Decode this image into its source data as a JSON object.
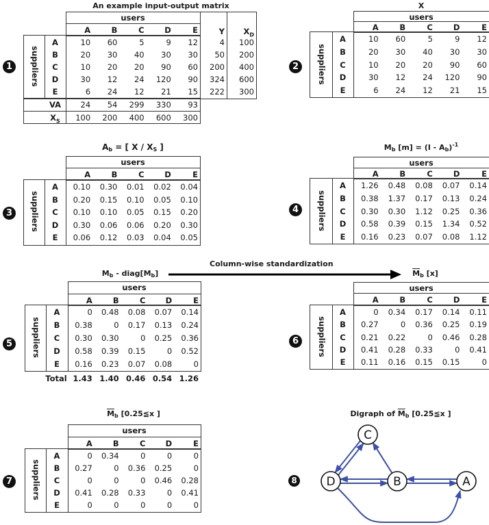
{
  "col_group_label": "users",
  "row_group_label": "suppliers",
  "columns": [
    "A",
    "B",
    "C",
    "D",
    "E"
  ],
  "rows": [
    "A",
    "B",
    "C",
    "D",
    "E"
  ],
  "panels": {
    "p1": {
      "badge": "1",
      "title": "An example input-output matrix",
      "extra_columns": [
        "Y",
        "X",
        "D"
      ],
      "values": [
        [
          "10",
          "60",
          "5",
          "9",
          "12"
        ],
        [
          "20",
          "30",
          "40",
          "30",
          "30"
        ],
        [
          "10",
          "20",
          "20",
          "90",
          "60"
        ],
        [
          "30",
          "12",
          "24",
          "120",
          "90"
        ],
        [
          "6",
          "24",
          "12",
          "21",
          "15"
        ]
      ],
      "y_values": [
        "4",
        "50",
        "200",
        "324",
        "222"
      ],
      "xd_values": [
        "100",
        "200",
        "400",
        "600",
        "300"
      ],
      "va_label": "VA",
      "va_values": [
        "24",
        "54",
        "299",
        "330",
        "93"
      ],
      "xs_label_main": "X",
      "xs_label_sub": "S",
      "xs_values": [
        "100",
        "200",
        "400",
        "600",
        "300"
      ]
    },
    "p2": {
      "badge": "2",
      "title": "X",
      "values": [
        [
          "10",
          "60",
          "5",
          "9",
          "12"
        ],
        [
          "20",
          "30",
          "40",
          "30",
          "30"
        ],
        [
          "10",
          "20",
          "20",
          "90",
          "60"
        ],
        [
          "30",
          "12",
          "24",
          "120",
          "90"
        ],
        [
          "6",
          "24",
          "12",
          "21",
          "15"
        ]
      ]
    },
    "p3": {
      "badge": "3",
      "title_parts": [
        "A",
        "b",
        " = [ X / X",
        "S",
        " ]"
      ],
      "values": [
        [
          "0.10",
          "0.30",
          "0.01",
          "0.02",
          "0.04"
        ],
        [
          "0.20",
          "0.15",
          "0.10",
          "0.05",
          "0.10"
        ],
        [
          "0.10",
          "0.10",
          "0.05",
          "0.15",
          "0.20"
        ],
        [
          "0.30",
          "0.06",
          "0.06",
          "0.20",
          "0.30"
        ],
        [
          "0.06",
          "0.12",
          "0.03",
          "0.04",
          "0.05"
        ]
      ]
    },
    "p4": {
      "badge": "4",
      "title_parts": [
        "M",
        "b",
        " [m]  =  (I - A",
        "b",
        ")",
        "-1"
      ],
      "values": [
        [
          "1.26",
          "0.48",
          "0.08",
          "0.07",
          "0.14"
        ],
        [
          "0.38",
          "1.37",
          "0.17",
          "0.13",
          "0.24"
        ],
        [
          "0.30",
          "0.30",
          "1.12",
          "0.25",
          "0.36"
        ],
        [
          "0.58",
          "0.39",
          "0.15",
          "1.34",
          "0.52"
        ],
        [
          "0.16",
          "0.23",
          "0.07",
          "0.08",
          "1.12"
        ]
      ]
    },
    "p5": {
      "badge": "5",
      "title_parts": [
        "M",
        "b",
        " - diag[M",
        "b",
        "]"
      ],
      "values": [
        [
          "0",
          "0.48",
          "0.08",
          "0.07",
          "0.14"
        ],
        [
          "0.38",
          "0",
          "0.17",
          "0.13",
          "0.24"
        ],
        [
          "0.30",
          "0.30",
          "0",
          "0.25",
          "0.36"
        ],
        [
          "0.58",
          "0.39",
          "0.15",
          "0",
          "0.52"
        ],
        [
          "0.16",
          "0.23",
          "0.07",
          "0.08",
          "0"
        ]
      ],
      "total_label": "Total",
      "totals": [
        "1.43",
        "1.40",
        "0.46",
        "0.54",
        "1.26"
      ]
    },
    "arrow": {
      "label": "Column-wise standardization"
    },
    "p6": {
      "badge": "6",
      "title_parts": [
        "M",
        "b",
        " [x]"
      ],
      "values": [
        [
          "0",
          "0.34",
          "0.17",
          "0.14",
          "0.11"
        ],
        [
          "0.27",
          "0",
          "0.36",
          "0.25",
          "0.19"
        ],
        [
          "0.21",
          "0.22",
          "0",
          "0.46",
          "0.28"
        ],
        [
          "0.41",
          "0.28",
          "0.33",
          "0",
          "0.41"
        ],
        [
          "0.11",
          "0.16",
          "0.15",
          "0.15",
          "0"
        ]
      ]
    },
    "p7": {
      "badge": "7",
      "title_parts": [
        "M",
        "b",
        " [0.25≦x ]"
      ],
      "values": [
        [
          "0",
          "0.34",
          "0",
          "0",
          "0"
        ],
        [
          "0.27",
          "0",
          "0.36",
          "0.25",
          "0"
        ],
        [
          "0",
          "0",
          "0",
          "0.46",
          "0.28"
        ],
        [
          "0.41",
          "0.28",
          "0.33",
          "0",
          "0.41"
        ],
        [
          "0",
          "0",
          "0",
          "0",
          "0"
        ]
      ]
    },
    "p8": {
      "badge": "8",
      "title_parts": [
        "Digraph of ",
        "M",
        "b",
        " [0.25≦x ]"
      ],
      "nodes": [
        "C",
        "D",
        "B",
        "A"
      ],
      "edges": [
        {
          "from": "D",
          "to": "C"
        },
        {
          "from": "C",
          "to": "D"
        },
        {
          "from": "B",
          "to": "C"
        },
        {
          "from": "B",
          "to": "D"
        },
        {
          "from": "D",
          "to": "B"
        },
        {
          "from": "A",
          "to": "B"
        },
        {
          "from": "B",
          "to": "A"
        },
        {
          "from": "D",
          "to": "A"
        }
      ],
      "edge_color": "#3a4fae"
    }
  }
}
